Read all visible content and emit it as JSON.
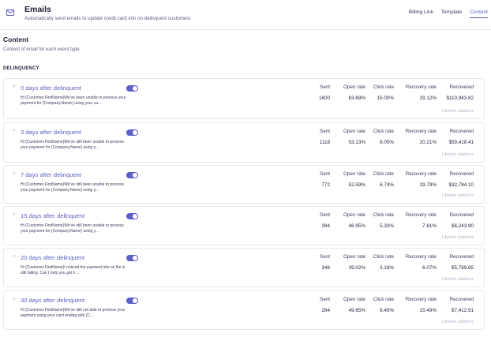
{
  "header": {
    "icon": "envelope-icon",
    "title": "Emails",
    "subtitle": "Automatically send emails to update credit card info on delinquent customers",
    "tabs": [
      "Billing Link",
      "Template",
      "Content"
    ],
    "active_tab": "Content"
  },
  "section": {
    "title": "Content",
    "subtitle": "Content of email for each event type.",
    "group_label": "DELINQUENCY"
  },
  "stat_labels": [
    "Sent",
    "Open rate",
    "Click rate",
    "Recovery rate",
    "Recovered"
  ],
  "lifetime_label": "Lifetime statistics",
  "colors": {
    "accent": "#5b5fc7",
    "text": "#1f2138",
    "muted": "#b3b6c8"
  },
  "emails": [
    {
      "title": "0 days after delinquent",
      "preview": "Hi {Customer.FirstName}We've been unable to process your payment for {Company.Name} using your ca...",
      "enabled": true,
      "stats": [
        "1600",
        "63.69%",
        "15.00%",
        "29.12%",
        "$110,943.82"
      ]
    },
    {
      "title": "3 days after delinquent",
      "preview": "Hi {Customer.FirstName}We've still been unable to process your payment for {Company.Name} using y...",
      "enabled": true,
      "stats": [
        "1118",
        "53.13%",
        "8.05%",
        "20.21%",
        "$59,418.41"
      ]
    },
    {
      "title": "7 days after delinquent",
      "preview": "Hi {Customer.FirstName}We've still been unable to process your payment for {Company.Name} using y...",
      "enabled": true,
      "stats": [
        "772",
        "52.59%",
        "6.74%",
        "29.79%",
        "$32,784.10"
      ]
    },
    {
      "title": "15 days after delinquent",
      "preview": "Hi {Customer.FirstName}We've still been unable to process your payment for {Company.Name} using y...",
      "enabled": true,
      "stats": [
        "394",
        "46.95%",
        "5.33%",
        "7.61%",
        "$6,243.90"
      ]
    },
    {
      "title": "20 days after delinquent",
      "preview": "Hi {Customer.FirstName}I noticed the payment info on file is still failing. Can I help you get it ...",
      "enabled": true,
      "stats": [
        "346",
        "39.02%",
        "3.18%",
        "6.07%",
        "$5,789.65"
      ]
    },
    {
      "title": "30 days after delinquent",
      "preview": "Hi {Customer.FirstName}We've still not able to process your payment using your card ending with {C...",
      "enabled": true,
      "stats": [
        "284",
        "49.65%",
        "8.45%",
        "15.49%",
        "$7,412.91"
      ]
    }
  ]
}
